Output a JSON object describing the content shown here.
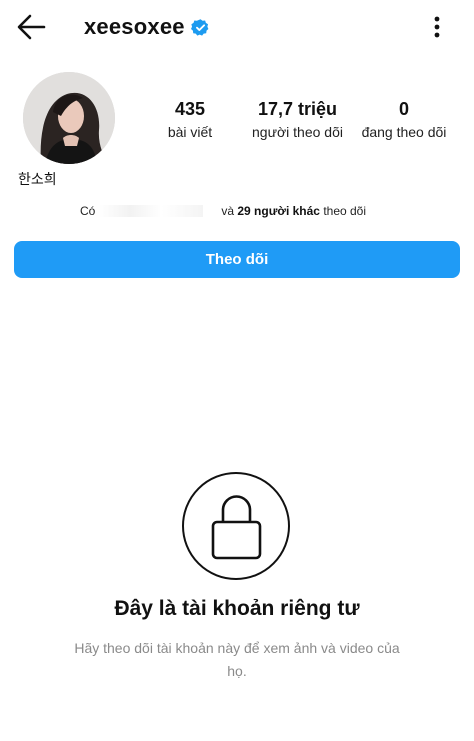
{
  "header": {
    "username": "xeesoxee",
    "back_icon": "arrow-left-icon",
    "verified_icon": "verified-badge-icon",
    "verified_color": "#1d9bf0",
    "more_icon": "more-vertical-icon"
  },
  "profile": {
    "display_name": "한소희",
    "stats": {
      "posts_value": "435",
      "posts_label": "bài viết",
      "followers_value": "17,7 triệu",
      "followers_label": "người theo dõi",
      "following_value": "0",
      "following_label": "đang theo dõi"
    },
    "mutual": {
      "prefix": "Có",
      "middle": "và",
      "count_text": "29 người khác",
      "suffix": "theo dõi"
    }
  },
  "actions": {
    "follow_label": "Theo dõi",
    "accent_color": "#1f9bf6"
  },
  "private_notice": {
    "icon": "lock-icon",
    "title": "Đây là tài khoản riêng tư",
    "description": "Hãy theo dõi tài khoản này để xem ảnh và video của họ."
  }
}
